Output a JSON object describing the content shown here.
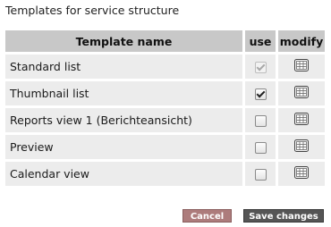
{
  "title": "Templates for service structure",
  "table": {
    "headers": {
      "name": "Template name",
      "use": "use",
      "modify": "modify"
    },
    "rows": [
      {
        "name": "Standard list",
        "use_checked": true,
        "use_disabled": true,
        "modify_icon": "edit-template-icon"
      },
      {
        "name": "Thumbnail list",
        "use_checked": true,
        "use_disabled": false,
        "modify_icon": "edit-template-icon"
      },
      {
        "name": "Reports view 1 (Berichteansicht)",
        "use_checked": false,
        "use_disabled": false,
        "modify_icon": "edit-template-icon"
      },
      {
        "name": "Preview",
        "use_checked": false,
        "use_disabled": false,
        "modify_icon": "edit-template-icon"
      },
      {
        "name": "Calendar view",
        "use_checked": false,
        "use_disabled": false,
        "modify_icon": "edit-template-icon"
      }
    ]
  },
  "buttons": {
    "cancel": "Cancel",
    "save": "Save changes"
  },
  "colors": {
    "header_bg": "#c8c8c8",
    "row_bg": "#ececec",
    "cancel_bg": "#ad7c7c",
    "save_bg": "#555555"
  }
}
